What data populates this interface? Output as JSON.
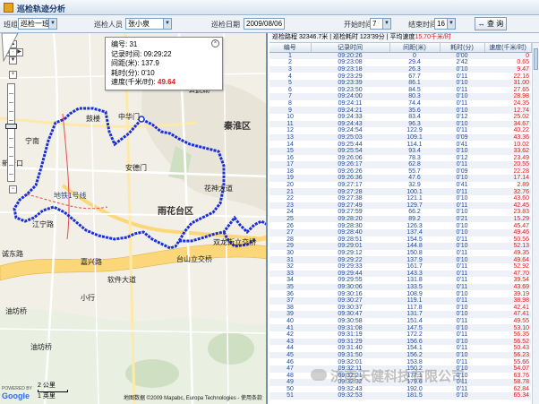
{
  "window": {
    "title": "巡检轨迹分析"
  },
  "toolbar": {
    "group_label": "班组",
    "group_value": "巡检一班",
    "inspector_label": "巡检人员",
    "inspector_value": "张小泉",
    "date_label": "巡检日期",
    "date_value": "2009/08/06",
    "start_label": "开始时间",
    "start_value": "7",
    "end_label": "结束时间",
    "end_value": "16",
    "query_label": "查 询"
  },
  "map": {
    "labels": {
      "qinhuai": "秦淮区",
      "yuhuatai": "雨花台区",
      "chengdong": "诚东路",
      "youfangqiao": "油坊桥",
      "youfangqiao2": "油坊桥",
      "xinjiekou": "新街口",
      "gulou": "鼓楼",
      "ningnan": "宁南",
      "shuanglong": "双龙街立交桥",
      "jiangning": "江宁路",
      "huashen": "花神大道",
      "metro": "地铁1号线",
      "xuanwu": "玄武湖",
      "zhonghua": "中华门",
      "ruanjian": "软件大道",
      "andemen": "安德门",
      "taishan": "台山立交桥",
      "jiaxing": "嘉兴路",
      "xiaoxing": "小行"
    },
    "popup": {
      "line1": "编号: 31",
      "line2": "记录时间: 09:29:22",
      "line3": "间距(米): 137.9",
      "line4": "耗时(分): 0'10",
      "line5_prefix": "速度(千米/时): ",
      "line5_value": "49.64"
    },
    "google": "Google",
    "powered": "POWERED BY",
    "scale_km": "2 公里",
    "scale_mi": "1 英里",
    "copyright": "地图数据 ©2009 Mapabc, Europa Technologies - 使用条款"
  },
  "summary": {
    "prefix": "巡检路程 ",
    "distance": "32346.7米",
    "mid": " | 巡检耗时 ",
    "duration": "123'39分",
    "speed_label": " | 平均速度",
    "speed": "15.70千米/时"
  },
  "table": {
    "headers": [
      "编号",
      "记录时间",
      "间距(米)",
      "耗时(分)",
      "速度(千米/时)"
    ],
    "rows": [
      [
        "1",
        "09:20:26",
        "0",
        "0'00",
        "0"
      ],
      [
        "2",
        "09:23:08",
        "29.4",
        "2'42",
        "0.65"
      ],
      [
        "3",
        "09:23:18",
        "26.3",
        "0'10",
        "9.47"
      ],
      [
        "4",
        "09:23:29",
        "67.7",
        "0'11",
        "22.16"
      ],
      [
        "5",
        "09:23:39",
        "86.1",
        "0'10",
        "31.00"
      ],
      [
        "6",
        "09:23:50",
        "84.5",
        "0'11",
        "27.65"
      ],
      [
        "7",
        "09:24:00",
        "80.3",
        "0'10",
        "28.98"
      ],
      [
        "8",
        "09:24:11",
        "74.4",
        "0'11",
        "24.35"
      ],
      [
        "9",
        "09:24:21",
        "35.6",
        "0'10",
        "12.74"
      ],
      [
        "10",
        "09:24:33",
        "83.4",
        "0'12",
        "25.02"
      ],
      [
        "11",
        "09:24:43",
        "96.3",
        "0'10",
        "34.67"
      ],
      [
        "12",
        "09:24:54",
        "122.9",
        "0'11",
        "40.22"
      ],
      [
        "13",
        "09:25:03",
        "109.1",
        "0'09",
        "43.36"
      ],
      [
        "14",
        "09:25:44",
        "114.1",
        "0'41",
        "10.02"
      ],
      [
        "15",
        "09:25:54",
        "93.4",
        "0'10",
        "33.62"
      ],
      [
        "16",
        "09:26:06",
        "78.3",
        "0'12",
        "23.49"
      ],
      [
        "17",
        "09:26:17",
        "62.8",
        "0'11",
        "20.55"
      ],
      [
        "18",
        "09:26:26",
        "55.7",
        "0'09",
        "22.28"
      ],
      [
        "19",
        "09:26:36",
        "47.6",
        "0'10",
        "17.14"
      ],
      [
        "20",
        "09:27:17",
        "32.9",
        "0'41",
        "2.89"
      ],
      [
        "21",
        "09:27:28",
        "100.1",
        "0'11",
        "32.76"
      ],
      [
        "22",
        "09:27:38",
        "121.1",
        "0'10",
        "43.60"
      ],
      [
        "23",
        "09:27:49",
        "129.7",
        "0'11",
        "42.45"
      ],
      [
        "24",
        "09:27:59",
        "66.2",
        "0'10",
        "23.83"
      ],
      [
        "25",
        "09:28:20",
        "89.2",
        "0'21",
        "15.29"
      ],
      [
        "26",
        "09:28:30",
        "126.3",
        "0'10",
        "45.47"
      ],
      [
        "27",
        "09:28:40",
        "137.4",
        "0'10",
        "49.46"
      ],
      [
        "28",
        "09:28:51",
        "154.5",
        "0'11",
        "50.56"
      ],
      [
        "29",
        "09:29:01",
        "144.8",
        "0'10",
        "52.13"
      ],
      [
        "30",
        "09:29:12",
        "150.8",
        "0'11",
        "49.35"
      ],
      [
        "31",
        "09:29:22",
        "137.9",
        "0'10",
        "49.64"
      ],
      [
        "32",
        "09:29:33",
        "161.7",
        "0'11",
        "52.92"
      ],
      [
        "33",
        "09:29:44",
        "143.3",
        "0'11",
        "47.70"
      ],
      [
        "34",
        "09:29:55",
        "131.8",
        "0'11",
        "39.54"
      ],
      [
        "35",
        "09:30:06",
        "133.5",
        "0'11",
        "43.69"
      ],
      [
        "36",
        "09:30:16",
        "108.9",
        "0'10",
        "39.19"
      ],
      [
        "37",
        "09:30:27",
        "119.1",
        "0'11",
        "38.98"
      ],
      [
        "38",
        "09:30:37",
        "117.8",
        "0'10",
        "42.41"
      ],
      [
        "39",
        "09:30:47",
        "131.7",
        "0'10",
        "47.41"
      ],
      [
        "40",
        "09:30:58",
        "151.4",
        "0'11",
        "49.55"
      ],
      [
        "41",
        "09:31:08",
        "147.5",
        "0'10",
        "53.10"
      ],
      [
        "42",
        "09:31:19",
        "172.2",
        "0'11",
        "56.35"
      ],
      [
        "43",
        "09:31:29",
        "156.6",
        "0'10",
        "56.52"
      ],
      [
        "44",
        "09:31:40",
        "154.1",
        "0'11",
        "50.43"
      ],
      [
        "45",
        "09:31:50",
        "156.2",
        "0'10",
        "56.23"
      ],
      [
        "46",
        "09:32:01",
        "153.8",
        "0'11",
        "55.66"
      ],
      [
        "47",
        "09:32:11",
        "150.2",
        "0'10",
        "54.07"
      ],
      [
        "48",
        "09:32:21",
        "177.1",
        "0'10",
        "63.76"
      ],
      [
        "49",
        "09:32:32",
        "179.6",
        "0'11",
        "58.78"
      ],
      [
        "50",
        "09:32:43",
        "192.0",
        "0'11",
        "62.84"
      ],
      [
        "51",
        "09:32:53",
        "181.5",
        "0'10",
        "65.34"
      ]
    ]
  },
  "watermark": "济南天健科技有限公司",
  "colors": {
    "track": "#1a2fd6",
    "speed_red": "#d42020",
    "header_blue": "#1d3d6a"
  }
}
